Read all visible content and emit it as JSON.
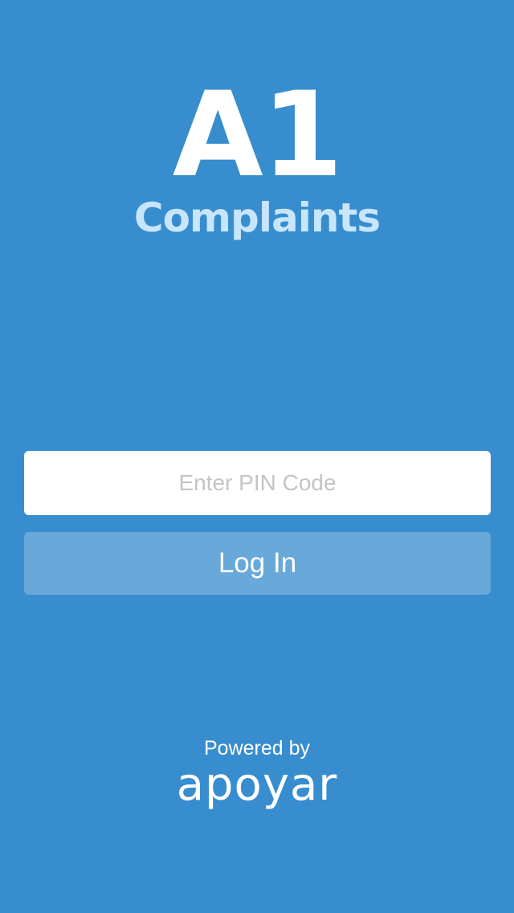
{
  "app": {
    "title": "A1",
    "subtitle": "Complaints"
  },
  "login": {
    "pin_placeholder": "Enter PIN Code",
    "pin_value": "",
    "button_label": "Log In"
  },
  "footer": {
    "powered_by": "Powered by",
    "brand_logo_text": "apoyar"
  },
  "colors": {
    "background": "#388dce",
    "subtitle": "#c8e6fb",
    "button": "#68a9d9",
    "input_background": "#ffffff",
    "placeholder": "#c4c4c4"
  }
}
